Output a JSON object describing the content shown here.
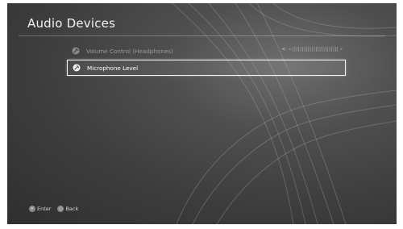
{
  "page": {
    "title": "Audio Devices"
  },
  "menu": {
    "items": [
      {
        "label": "Volume Control (Headphones)",
        "state": "disabled"
      },
      {
        "label": "Microphone Level",
        "state": "selected"
      }
    ],
    "volume_slider": {
      "left_glyph": "◂",
      "right_glyph": "▸",
      "speaker_glyph": "◀)"
    }
  },
  "footer": {
    "enter": {
      "glyph": "✕",
      "label": "Enter"
    },
    "back": {
      "glyph": "○",
      "label": "Back"
    }
  }
}
